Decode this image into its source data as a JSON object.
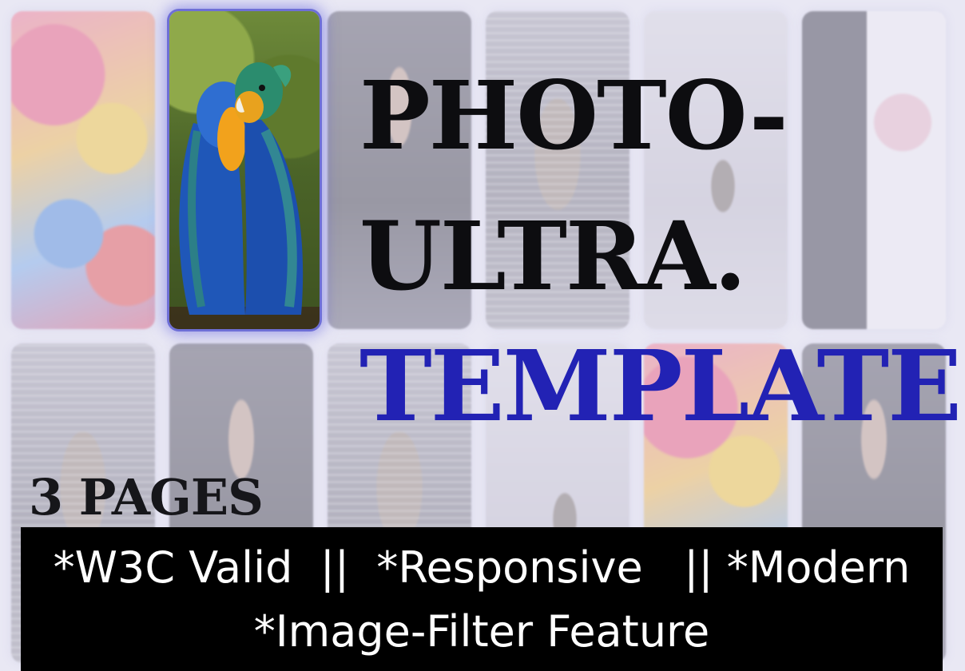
{
  "title": {
    "line1": "PHOTO-",
    "line2": "ULTRA.",
    "line3": "TEMPLATE"
  },
  "pages_label": "3 PAGES",
  "features": {
    "line1": "*W3C Valid  ||  *Responsive   || *Modern",
    "line2": "*Image-Filter Feature"
  },
  "colors": {
    "title_dark": "#0d0d10",
    "title_accent": "#2222b4",
    "feature_bar_bg": "#000000",
    "feature_bar_text": "#ffffff",
    "featured_glow": "#6e6fd6"
  },
  "images": {
    "featured": "parrots-photo",
    "background_tiles": [
      "face-paint-photo",
      "man-portrait-photo",
      "woman-portrait-photo",
      "landscape-photo",
      "wedding-photo"
    ]
  }
}
